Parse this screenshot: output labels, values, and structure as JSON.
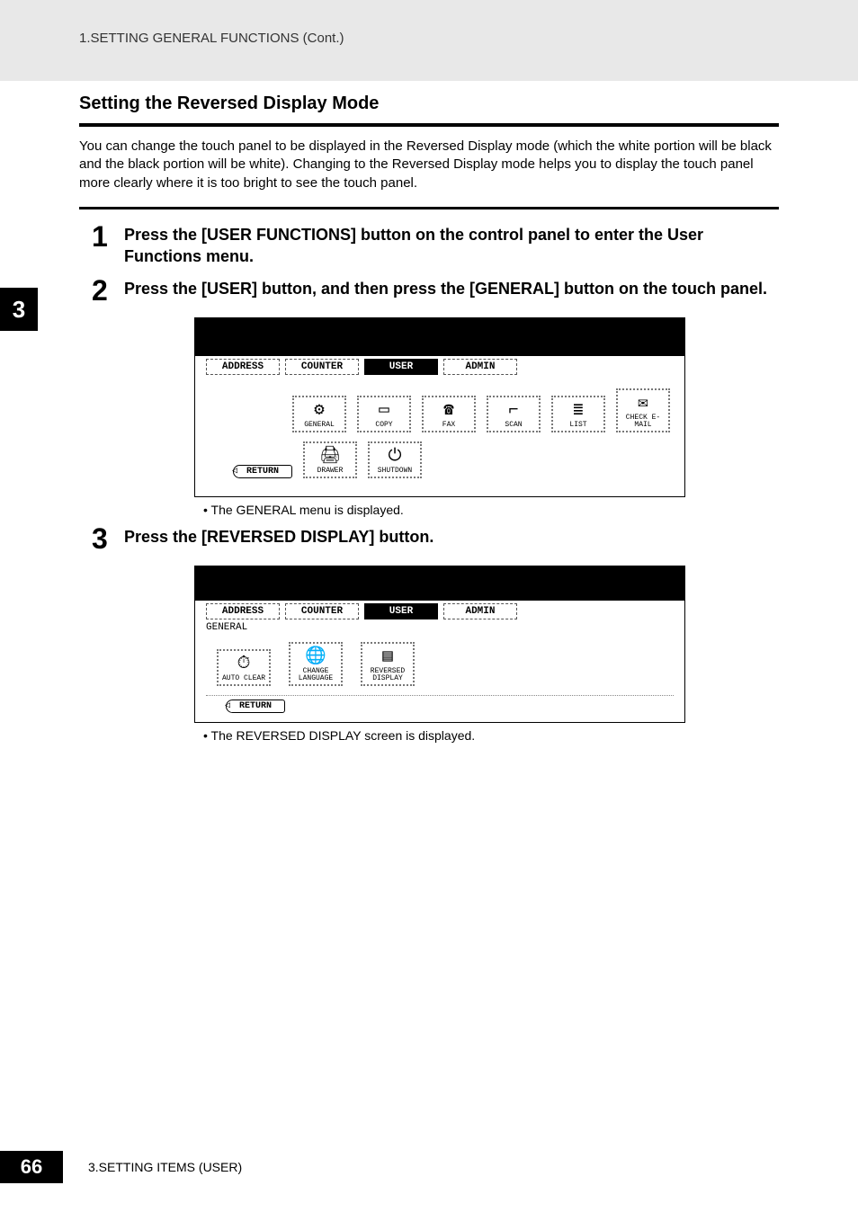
{
  "header": {
    "running": "1.SETTING GENERAL FUNCTIONS (Cont.)"
  },
  "section": {
    "title": "Setting the Reversed Display Mode",
    "intro": "You can change the touch panel to be displayed in the Reversed Display mode (which the white portion will be black and the black portion will be white).\nChanging to the Reversed Display mode helps you to display the touch panel more clearly where it is too bright to see the touch panel."
  },
  "side_tab": "3",
  "steps": [
    {
      "num": "1",
      "text": "Press the [USER FUNCTIONS] button on the control panel to enter the User Functions menu."
    },
    {
      "num": "2",
      "text": "Press the [USER] button, and then press the [GENERAL] button on the touch panel."
    },
    {
      "num": "3",
      "text": "Press the [REVERSED DISPLAY] button."
    }
  ],
  "bullets": {
    "after2": "The GENERAL menu is displayed.",
    "after3": "The REVERSED DISPLAY screen is displayed."
  },
  "shot1": {
    "tabs": [
      "ADDRESS",
      "COUNTER",
      "USER",
      "ADMIN"
    ],
    "active_tab": "USER",
    "row1": [
      {
        "glyph": "⚙",
        "label": "GENERAL"
      },
      {
        "glyph": "▭",
        "label": "COPY"
      },
      {
        "glyph": "☎",
        "label": "FAX"
      },
      {
        "glyph": "⌐",
        "label": "SCAN"
      },
      {
        "glyph": "≣",
        "label": "LIST"
      },
      {
        "glyph": "✉",
        "label": "CHECK E-MAIL"
      }
    ],
    "row2": [
      {
        "glyph": "🖨",
        "label": "DRAWER"
      },
      {
        "glyph": "⏻",
        "label": "SHUTDOWN"
      }
    ],
    "return": "RETURN"
  },
  "shot2": {
    "tabs": [
      "ADDRESS",
      "COUNTER",
      "USER",
      "ADMIN"
    ],
    "active_tab": "USER",
    "sublabel": "GENERAL",
    "row1": [
      {
        "glyph": "⏱",
        "label": "AUTO CLEAR"
      },
      {
        "glyph": "🌐",
        "label": "CHANGE LANGUAGE"
      },
      {
        "glyph": "▤",
        "label": "REVERSED DISPLAY"
      }
    ],
    "return": "RETURN"
  },
  "footer": {
    "page": "66",
    "text": "3.SETTING ITEMS (USER)"
  }
}
